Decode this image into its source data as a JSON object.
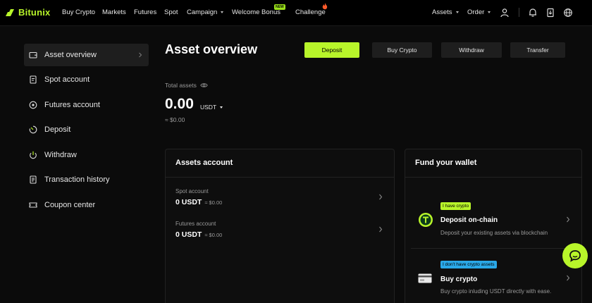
{
  "brand": {
    "name": "Bitunix",
    "accent": "#b8f52a"
  },
  "nav": {
    "items": [
      "Buy Crypto",
      "Markets",
      "Futures",
      "Spot",
      "Campaign",
      "Welcome Bonus",
      "Challenge"
    ],
    "new_badge": "NEW",
    "right_items": [
      "Assets",
      "Order"
    ],
    "icons": [
      "user-icon",
      "bell-icon",
      "download-icon",
      "globe-icon"
    ]
  },
  "sidebar": {
    "items": [
      {
        "label": "Asset overview",
        "icon": "wallet-icon"
      },
      {
        "label": "Spot account",
        "icon": "document-icon"
      },
      {
        "label": "Futures account",
        "icon": "futures-icon"
      },
      {
        "label": "Deposit",
        "icon": "deposit-icon"
      },
      {
        "label": "Withdraw",
        "icon": "power-icon"
      },
      {
        "label": "Transaction history",
        "icon": "history-icon"
      },
      {
        "label": "Coupon center",
        "icon": "coupon-icon"
      }
    ]
  },
  "main": {
    "title": "Asset overview",
    "actions": [
      "Deposit",
      "Buy Crypto",
      "Withdraw",
      "Transfer"
    ],
    "total": {
      "label": "Total assets",
      "value": "0.00",
      "unit": "USDT",
      "fiat": "≈ $0.00"
    }
  },
  "assets_account": {
    "title": "Assets account",
    "rows": [
      {
        "label": "Spot account",
        "value": "0 USDT",
        "fiat": "≈ $0.00"
      },
      {
        "label": "Futures account",
        "value": "0 USDT",
        "fiat": "≈ $0.00"
      }
    ]
  },
  "fund_wallet": {
    "title": "Fund your wallet",
    "options": [
      {
        "tag": "I have crypto",
        "title": "Deposit on-chain",
        "desc": "Deposit your existing assets via blockchain"
      },
      {
        "tag": "I don't have crypto assets",
        "title": "Buy crypto",
        "desc": "Buy crypto inluding USDT directly with ease."
      }
    ]
  }
}
